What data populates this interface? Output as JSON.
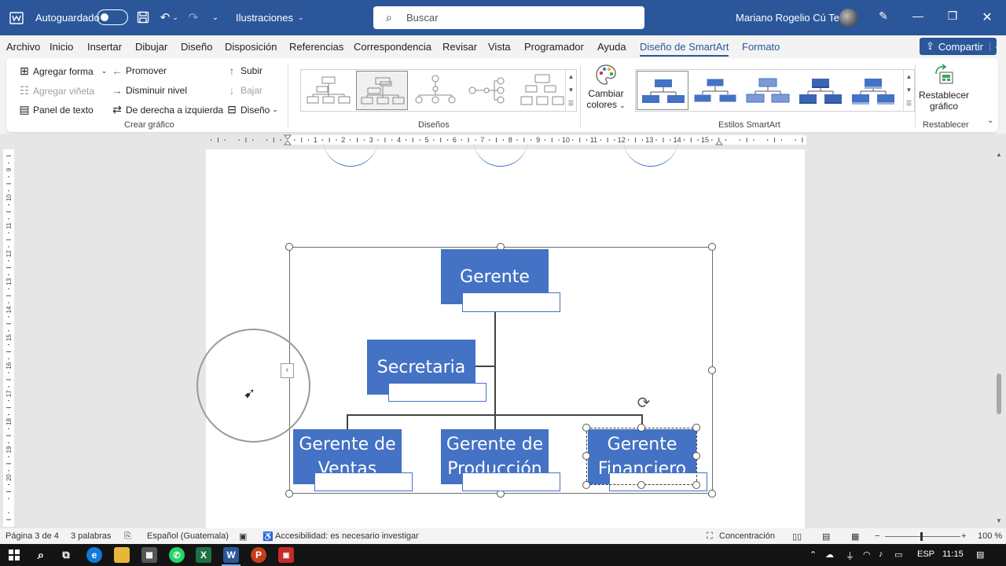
{
  "titlebar": {
    "autosave_label": "Autoguardado",
    "doc_name": "Ilustraciones",
    "search_placeholder": "Buscar",
    "user_name": "Mariano Rogelio Cú Tecú"
  },
  "menu": {
    "tabs": [
      "Archivo",
      "Inicio",
      "Insertar",
      "Dibujar",
      "Diseño",
      "Disposición",
      "Referencias",
      "Correspondencia",
      "Revisar",
      "Vista",
      "Programador",
      "Ayuda",
      "Diseño de SmartArt",
      "Formato"
    ],
    "active_tab": "Diseño de SmartArt",
    "share_label": "Compartir"
  },
  "ribbon": {
    "crear_grafico": {
      "label": "Crear gráfico",
      "agregar_forma": "Agregar forma",
      "agregar_vineta": "Agregar viñeta",
      "panel_texto": "Panel de texto",
      "promover": "Promover",
      "disminuir_nivel": "Disminuir nivel",
      "derecha_izquierda": "De derecha a izquierda",
      "subir": "Subir",
      "bajar": "Bajar",
      "diseno": "Diseño"
    },
    "disenos": {
      "label": "Diseños"
    },
    "estilos": {
      "label": "Estilos SmartArt",
      "cambiar_colores_line1": "Cambiar",
      "cambiar_colores_line2": "colores"
    },
    "restablecer": {
      "label": "Restablecer",
      "button_line1": "Restablecer",
      "button_line2": "gráfico"
    }
  },
  "ruler": {
    "horizontal_ticks": [
      "1",
      "2",
      "3",
      "4",
      "5",
      "6",
      "7",
      "8",
      "9",
      "10",
      "11",
      "12",
      "13",
      "14",
      "15"
    ],
    "vertical_ticks": [
      "9",
      "10",
      "11",
      "12",
      "13",
      "14",
      "15",
      "16",
      "17",
      "18",
      "19",
      "20"
    ]
  },
  "smartart": {
    "gerente": "Gerente",
    "secretaria": "Secretaria",
    "ventas_line1": "Gerente de",
    "ventas_line2": "Ventas",
    "produccion_line1": "Gerente de",
    "produccion_line2": "Producción",
    "financiero_line1": "Gerente",
    "financiero_line2": "Financiero",
    "box_color": "#4472c4"
  },
  "statusbar": {
    "page": "Página 3 de 4",
    "words": "3 palabras",
    "language": "Español (Guatemala)",
    "accessibility": "Accesibilidad: es necesario investigar",
    "focus": "Concentración",
    "zoom": "100 %"
  },
  "taskbar": {
    "language": "ESP",
    "time": "11:15"
  },
  "colors": {
    "title_blue": "#2b579a",
    "smartart_blue": "#4472c4"
  }
}
